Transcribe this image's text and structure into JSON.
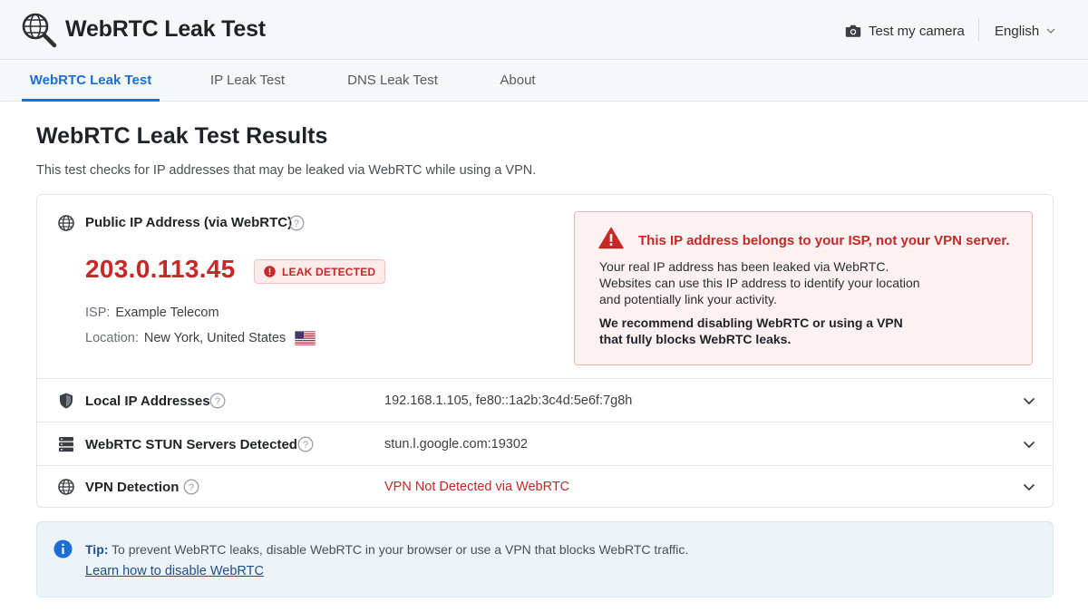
{
  "header": {
    "app_title": "WebRTC Leak Test",
    "camera_label": "Test my camera",
    "language": "English"
  },
  "tabs": [
    {
      "label": "WebRTC Leak Test",
      "active": true
    },
    {
      "label": "IP Leak Test",
      "active": false
    },
    {
      "label": "DNS Leak Test",
      "active": false
    },
    {
      "label": "About",
      "active": false
    }
  ],
  "main": {
    "title": "WebRTC Leak Test Results",
    "description": "This test checks for IP addresses that may be leaked via WebRTC while using a VPN."
  },
  "public_ip": {
    "label": "Public IP Address (via WebRTC)",
    "ip": "203.0.113.45",
    "badge": "LEAK DETECTED",
    "isp_key": "ISP:",
    "isp_value": "Example Telecom",
    "location_key": "Location:",
    "location_value": "New York, United States"
  },
  "alert": {
    "title": "This IP address belongs to your ISP, not your VPN server.",
    "line1": "Your real IP address has been leaked via WebRTC.",
    "line2": "Websites can use this IP address to identify your location",
    "line3": "and potentially link your activity.",
    "strong1": "We recommend disabling WebRTC or using a VPN",
    "strong2": "that fully blocks WebRTC leaks."
  },
  "rows": [
    {
      "label": "Local IP Addresses",
      "value": "192.168.1.105, fe80::1a2b:3c4d:5e6f:7g8h"
    },
    {
      "label": "WebRTC STUN Servers Detected",
      "value": "stun.l.google.com:19302"
    },
    {
      "label": "VPN Detection",
      "value": "VPN Not Detected via WebRTC"
    }
  ],
  "tip": {
    "label": "Tip:",
    "text": "To prevent WebRTC leaks, disable WebRTC in your browser or use a VPN that blocks WebRTC traffic.",
    "link": "Learn how to disable WebRTC"
  },
  "colors": {
    "accent": "#1a6fd1",
    "danger": "#c62828",
    "alert_bg": "#fdf1f1",
    "tip_bg": "#eef3fa"
  },
  "icons": [
    "magnifier-globe-icon",
    "camera-icon",
    "chevron-down-icon",
    "globe-icon",
    "help-icon",
    "error-icon",
    "warning-icon",
    "shield-icon",
    "server-icon",
    "info-icon",
    "us-flag-icon"
  ]
}
